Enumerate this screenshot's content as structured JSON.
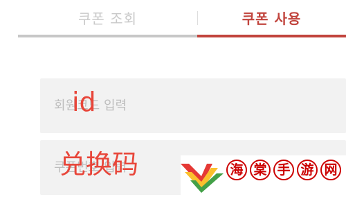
{
  "tabs": [
    {
      "label": "쿠폰 조회",
      "active": false
    },
    {
      "label": "쿠폰 사용",
      "active": true
    }
  ],
  "form": {
    "member_code_placeholder": "회원코드 입력",
    "member_code_value": "",
    "coupon_code_placeholder": "쿠폰번호 입력",
    "coupon_code_value": ""
  },
  "annotations": {
    "id_label": "id",
    "redeem_label": "兑换码"
  },
  "watermark": {
    "chars": [
      "海",
      "棠",
      "手",
      "游",
      "网"
    ]
  },
  "colors": {
    "accent": "#c1443d",
    "inactive_tab_text": "#c9c9c9",
    "inactive_underline": "#c7c7c7",
    "field_bg": "#f2f2f2",
    "annotation": "#e8463a",
    "watermark_red": "#cc0000"
  }
}
